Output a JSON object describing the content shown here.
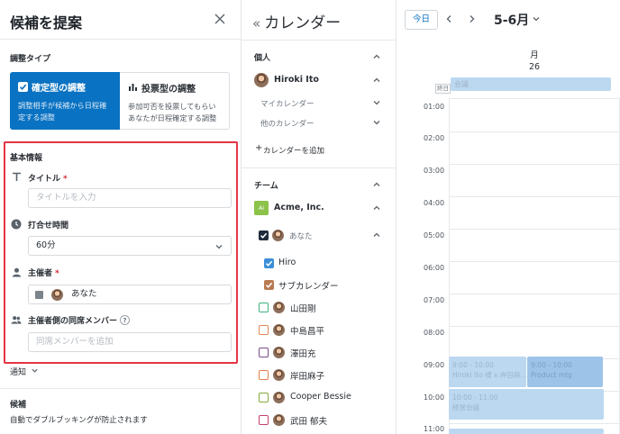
{
  "left": {
    "title": "候補を提案",
    "type_section_label": "調整タイプ",
    "type_fixed": {
      "title": "確定型の調整",
      "desc1": "調整相手が候補から日程確",
      "desc2": "定する調整"
    },
    "type_poll": {
      "title": "投票型の調整",
      "desc1": "参加可否を投票してもらい",
      "desc2": "あなたが日程確定する調整"
    },
    "basic_section_label": "基本情報",
    "title_label": "タイトル",
    "title_placeholder": "タイトルを入力",
    "duration_label": "打合せ時間",
    "duration_value": "60分",
    "organizer_label": "主催者",
    "organizer_value": "あなた",
    "members_label": "主催者側の同席メンバー",
    "members_help": "?",
    "members_placeholder": "同席メンバーを追加",
    "notify_label": "通知",
    "candidates_label": "候補",
    "candidates_desc": "自動でダブルブッキングが防止されます",
    "required_mark": "*"
  },
  "mid": {
    "title": "カレンダー",
    "personal_label": "個人",
    "personal_user": "Hiroki Ito",
    "my_calendar": "マイカレンダー",
    "other_calendar": "他のカレンダー",
    "add_calendar": "カレンダーを追加",
    "team_label": "チーム",
    "team_name": "Acme, Inc.",
    "team_badge": "Ai",
    "you": "あなた",
    "calendars": [
      {
        "name": "Hiro",
        "color": "#3b8fd9",
        "checked": true
      },
      {
        "name": "サブカレンダー",
        "color": "#b97a52",
        "checked": true
      }
    ],
    "members": [
      {
        "name": "山田剛",
        "color": "#3fb27f"
      },
      {
        "name": "中島昌平",
        "color": "#e08a55"
      },
      {
        "name": "澤田充",
        "color": "#7a4d8c"
      },
      {
        "name": "岸田麻子",
        "color": "#e0804f"
      },
      {
        "name": "Cooper Bessie",
        "color": "#86a83c"
      },
      {
        "name": "武田 郁夫",
        "color": "#c2426a"
      }
    ]
  },
  "cal": {
    "today_label": "今日",
    "month_label": "5-6月",
    "day_name": "月",
    "day_number": "26",
    "allday_label": "終日",
    "allday_event": "会議",
    "hours": [
      "01:00",
      "02:00",
      "03:00",
      "04:00",
      "05:00",
      "06:00",
      "07:00",
      "08:00",
      "09:00",
      "10:00",
      "11:00"
    ],
    "events": [
      {
        "time": "9:00 - 10:00",
        "title": "Hiroki Ito 様 x 岸田麻…"
      },
      {
        "time": "9:00 - 10:00",
        "title": "Product mtg"
      },
      {
        "time": "10:00 - 11:00",
        "title": "経営会議"
      }
    ],
    "colors": {
      "event": "#bcd8f1",
      "event_dark": "#9ec3e8",
      "accent": "#0a72c2"
    }
  }
}
